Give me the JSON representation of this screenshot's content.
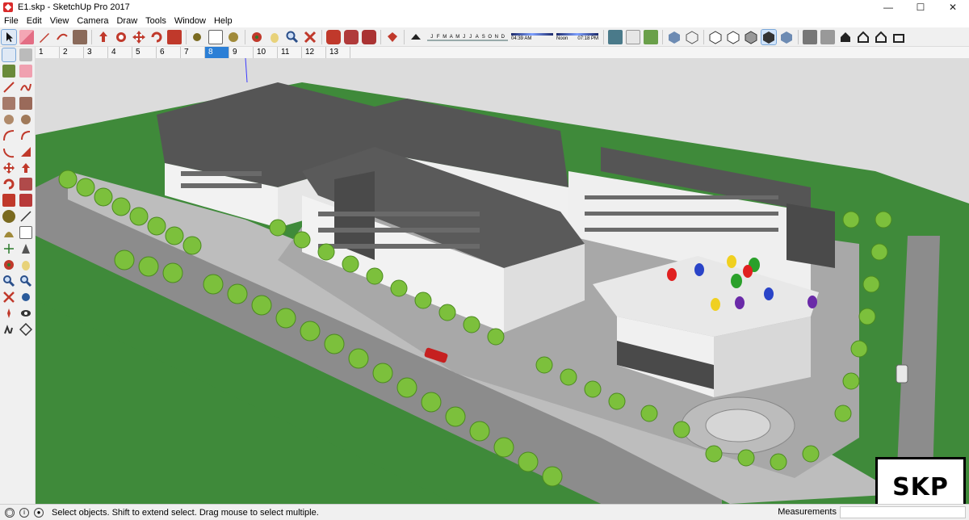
{
  "window": {
    "title": "E1.skp - SketchUp Pro 2017",
    "minimize_glyph": "—",
    "maximize_glyph": "☐",
    "close_glyph": "✕"
  },
  "menu": [
    "File",
    "Edit",
    "View",
    "Camera",
    "Draw",
    "Tools",
    "Window",
    "Help"
  ],
  "shadow_settings": {
    "months": [
      "J",
      "F",
      "M",
      "A",
      "M",
      "J",
      "J",
      "A",
      "S",
      "O",
      "N",
      "D"
    ],
    "time_start": "04:39 AM",
    "time_mid": "Noon",
    "time_end": "07:18 PM"
  },
  "scenes": {
    "tabs": [
      "1",
      "2",
      "3",
      "4",
      "5",
      "6",
      "7",
      "8",
      "9",
      "10",
      "11",
      "12",
      "13"
    ],
    "active": "8"
  },
  "status": {
    "hint": "Select objects. Shift to extend select. Drag mouse to select multiple.",
    "measurements_label": "Measurements",
    "measurements_value": ""
  },
  "badge": {
    "text": "SKP"
  },
  "colors": {
    "sky": "#d9d9d9",
    "grass": "#3f8a3a",
    "road": "#8c8c8c",
    "roof": "#555555",
    "wall": "#f2f2f2",
    "tree": "#7cc03c",
    "accent_tab": "#2b7fd6"
  },
  "icons": {
    "toolbar": [
      "select-icon",
      "eraser-icon",
      "pencil-icon",
      "shape-icon",
      "paint-bucket-icon",
      "push-pull-icon",
      "follow-me-icon",
      "move-icon",
      "rotate-icon",
      "scale-icon",
      "tape-measure-icon",
      "text-icon",
      "paint-icon",
      "orbit-icon",
      "pan-icon",
      "zoom-icon",
      "zoom-extents-icon",
      "warehouse-icon",
      "components-icon",
      "extension-icon",
      "ruby-icon",
      "shadows-icon",
      "fog-icon",
      "section-icon",
      "xray-icon",
      "backedges-icon",
      "wireframe-icon",
      "hidden-line-icon",
      "shaded-icon",
      "textured-icon",
      "monochrome-icon",
      "iso-icon",
      "top-view-icon",
      "front-view-icon",
      "right-view-icon",
      "back-view-icon",
      "left-view-icon"
    ],
    "left": [
      "select-icon",
      "component-icon",
      "paint-bucket-icon",
      "eraser-icon",
      "line-icon",
      "freehand-icon",
      "rectangle-icon",
      "rotated-rect-icon",
      "circle-icon",
      "polygon-icon",
      "arc-icon",
      "pie-icon",
      "move-icon",
      "push-pull-icon",
      "rotate-icon",
      "follow-me-icon",
      "scale-icon",
      "offset-icon",
      "tape-icon",
      "dimension-icon",
      "protractor-icon",
      "text-icon",
      "axes-icon",
      "3d-text-icon",
      "orbit-icon",
      "pan-icon",
      "zoom-icon",
      "zoom-window-icon",
      "zoom-extents-icon",
      "previous-icon",
      "position-camera-icon",
      "look-around-icon",
      "walk-icon",
      "section-plane-icon"
    ]
  }
}
